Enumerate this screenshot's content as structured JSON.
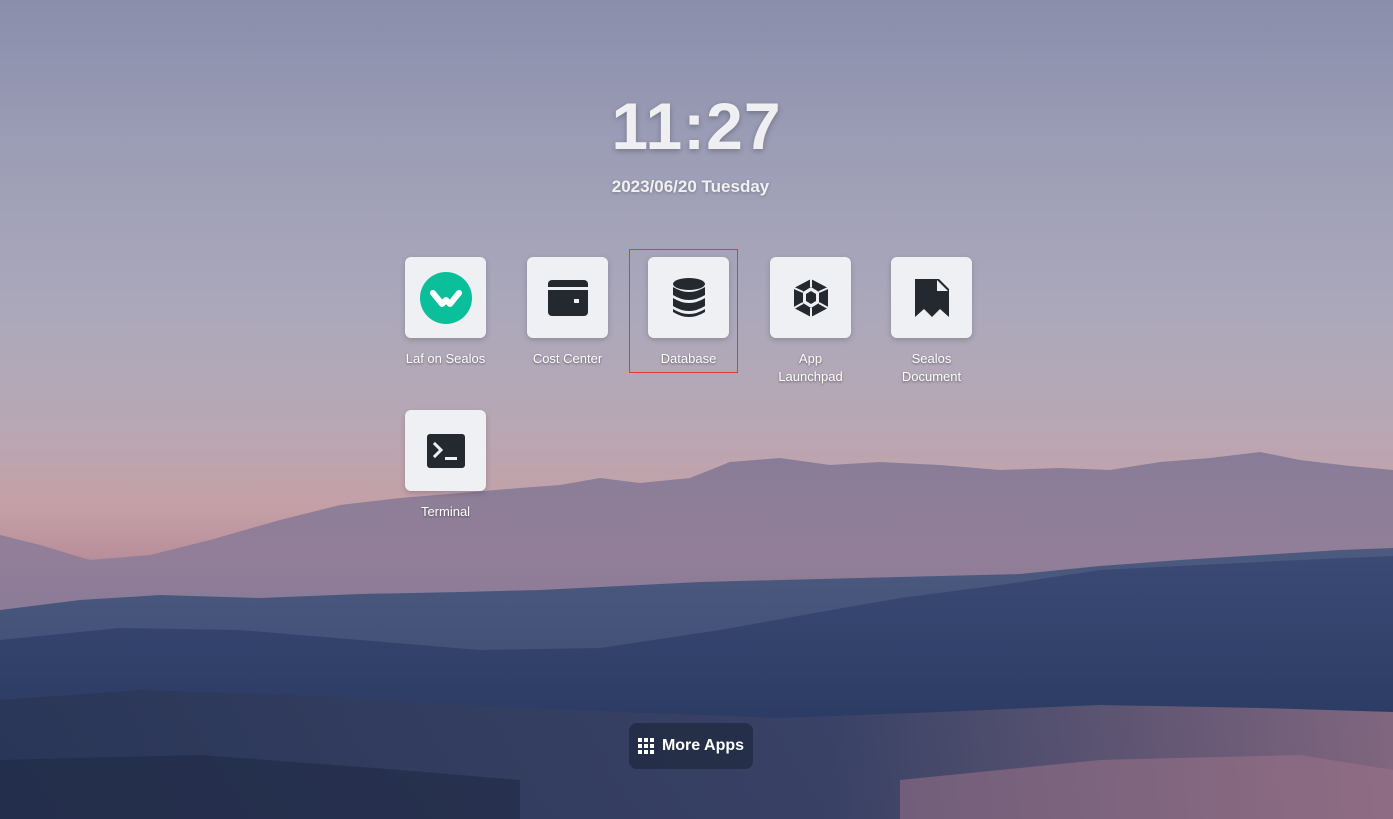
{
  "clock": {
    "time": "11:27",
    "date": "2023/06/20 Tuesday"
  },
  "apps": [
    {
      "label": "Laf on Sealos",
      "icon": "laf-logo-icon",
      "accent": "#0bbf9b"
    },
    {
      "label": "Cost Center",
      "icon": "wallet-icon"
    },
    {
      "label": "Database",
      "icon": "database-icon",
      "selected": true
    },
    {
      "label": "App Launchpad",
      "icon": "polyhedron-icon"
    },
    {
      "label": "Sealos Document",
      "icon": "document-bookmark-icon"
    },
    {
      "label": "Terminal",
      "icon": "terminal-icon"
    }
  ],
  "more_apps": {
    "label": "More Apps",
    "icon": "grid-icon"
  },
  "colors": {
    "icon_dark": "#24282f",
    "tile_bg": "#eff0f3",
    "selection_border": "#e53935"
  }
}
